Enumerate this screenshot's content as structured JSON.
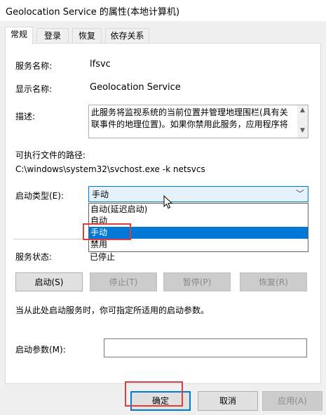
{
  "window": {
    "title": "Geolocation Service 的属性(本地计算机)"
  },
  "tabs": [
    {
      "label": "常规",
      "active": true
    },
    {
      "label": "登录"
    },
    {
      "label": "恢复"
    },
    {
      "label": "依存关系"
    }
  ],
  "general": {
    "service_name_label": "服务名称:",
    "service_name_value": "lfsvc",
    "display_name_label": "显示名称:",
    "display_name_value": "Geolocation Service",
    "description_label": "描述:",
    "description_text": "此服务将监视系统的当前位置并管理地理围栏(具有关联事件的地理位置)。如果你禁用此服务，应用程序将",
    "exe_path_label": "可执行文件的路径:",
    "exe_path_value": "C:\\windows\\system32\\svchost.exe -k netsvcs",
    "startup_type_label": "启动类型(E):",
    "startup_type_selected": "手动",
    "startup_options": [
      "自动(延迟启动)",
      "自动",
      "手动",
      "禁用"
    ],
    "service_status_label": "服务状态:",
    "service_status_value": "已停止",
    "buttons": {
      "start": "启动(S)",
      "stop": "停止(T)",
      "pause": "暂停(P)",
      "resume": "恢复(R)"
    },
    "hint_text": "当从此处启动服务时，你可指定所适用的启动参数。",
    "start_params_label": "启动参数(M):",
    "start_params_value": ""
  },
  "footer": {
    "ok_label": "确定",
    "cancel_label": "取消",
    "apply_label": "应用(A)"
  },
  "colors": {
    "highlight_box": "#e03c3c",
    "accent": "#0078d7"
  }
}
